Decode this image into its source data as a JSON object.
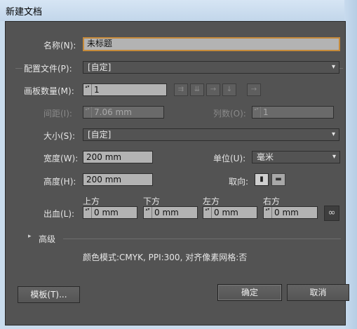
{
  "window": {
    "title": "新建文档"
  },
  "form": {
    "name_label": "名称(N):",
    "name_value": "未标题",
    "profile_label": "配置文件(P):",
    "profile_value": "[自定]",
    "artboards_label": "画板数量(M):",
    "artboards_value": "1",
    "spacing_label": "间距(I):",
    "spacing_value": "7.06 mm",
    "columns_label": "列数(O):",
    "columns_value": "1",
    "size_label": "大小(S):",
    "size_value": "[自定]",
    "width_label": "宽度(W):",
    "width_value": "200 mm",
    "units_label": "单位(U):",
    "units_value": "毫米",
    "height_label": "高度(H):",
    "height_value": "200 mm",
    "orientation_label": "取向:",
    "bleed_label": "出血(L):",
    "bleed_top_label": "上方",
    "bleed_top_value": "0 mm",
    "bleed_bottom_label": "下方",
    "bleed_bottom_value": "0 mm",
    "bleed_left_label": "左方",
    "bleed_left_value": "0 mm",
    "bleed_right_label": "右方",
    "bleed_right_value": "0 mm",
    "advanced_label": "高级",
    "color_mode_info": "颜色模式:CMYK, PPI:300, 对齐像素网格:否"
  },
  "buttons": {
    "templates": "模板(T)...",
    "ok": "确定",
    "cancel": "取消"
  },
  "icons": {
    "dropdown": "▾",
    "spin": "▴▾",
    "arrange_grid_row": "⇉",
    "arrange_grid_col": "⇊",
    "arrange_row": "→",
    "arrange_col": "↓",
    "layout_direction": "→",
    "portrait": "▮",
    "landscape": "▬",
    "link": "∞",
    "disclosure": "▸"
  },
  "colors": {
    "dialog_bg": "#535353",
    "focus_border": "#c58a3a"
  }
}
